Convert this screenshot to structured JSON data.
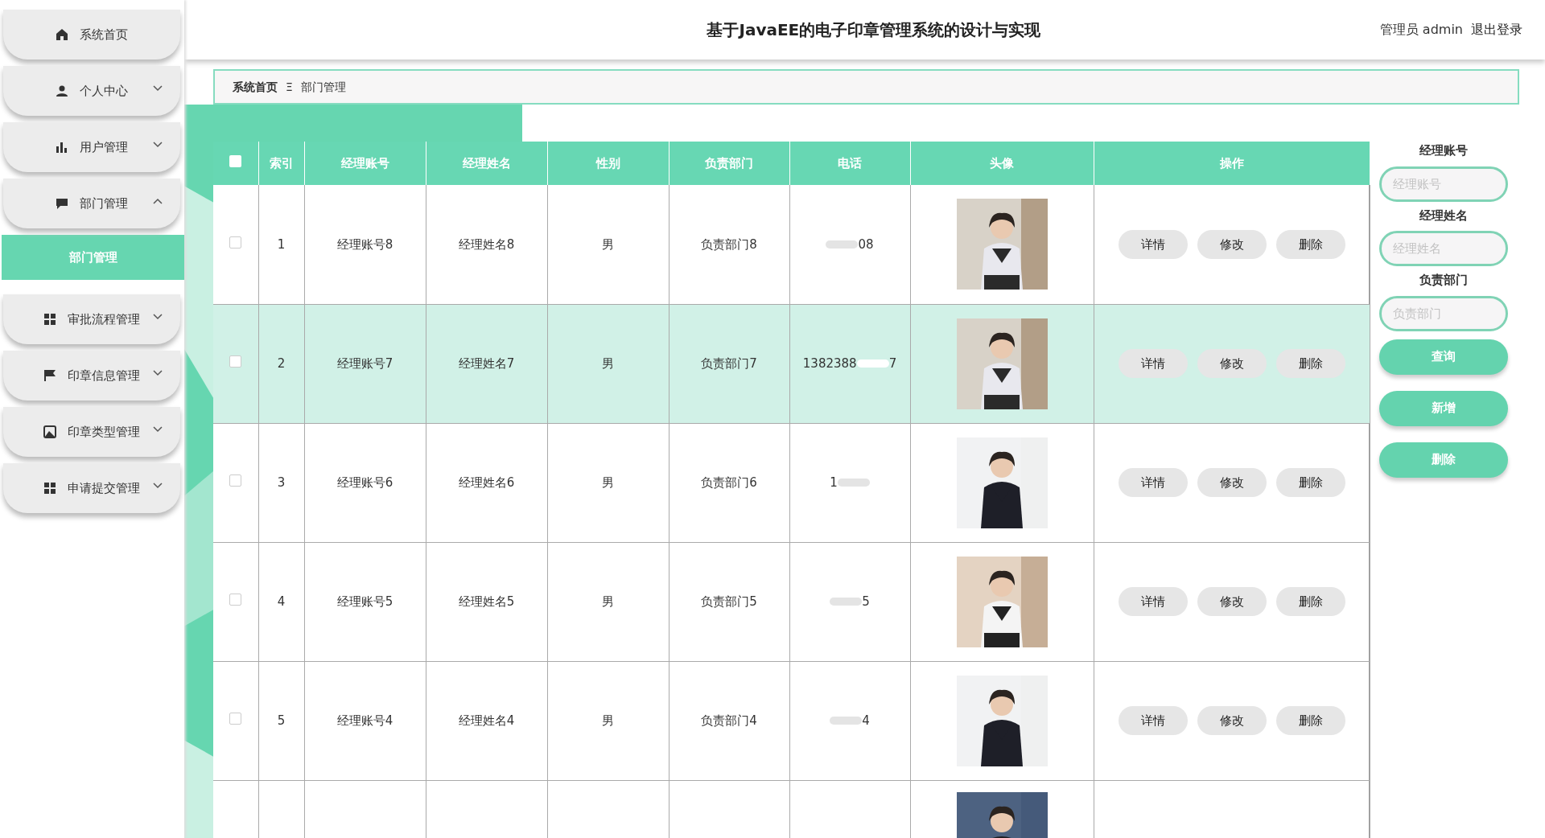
{
  "sidebar": {
    "items": [
      {
        "label": "系统首页",
        "kind": "link"
      },
      {
        "label": "个人中心",
        "kind": "menu",
        "expanded": false
      },
      {
        "label": "用户管理",
        "kind": "menu",
        "expanded": false
      },
      {
        "label": "部门管理",
        "kind": "menu",
        "expanded": true,
        "children": [
          {
            "label": "部门管理",
            "selected": true
          }
        ]
      },
      {
        "label": "审批流程管理",
        "kind": "menu",
        "expanded": false
      },
      {
        "label": "印章信息管理",
        "kind": "menu",
        "expanded": false
      },
      {
        "label": "印章类型管理",
        "kind": "menu",
        "expanded": false
      },
      {
        "label": "申请提交管理",
        "kind": "menu",
        "expanded": false
      }
    ]
  },
  "header": {
    "title": "基于JavaEE的电子印章管理系统的设计与实现",
    "user": "管理员 admin",
    "logout": "退出登录"
  },
  "breadcrumb": {
    "home": "系统首页",
    "separator": "Ξ",
    "current": "部门管理"
  },
  "table": {
    "select_all_checked": false,
    "columns": [
      "索引",
      "经理账号",
      "经理姓名",
      "性别",
      "负责部门",
      "电话",
      "头像",
      "操作"
    ],
    "rows": [
      {
        "kind": "full",
        "index": "1",
        "account": "经理账号8",
        "name": "经理姓名8",
        "gender": "男",
        "dept": "负责部门8",
        "phone_start": "",
        "phone_end": "08",
        "selected": false,
        "checked": false,
        "actions": [
          "详情",
          "修改",
          "删除"
        ]
      },
      {
        "kind": "full",
        "index": "2",
        "account": "经理账号7",
        "name": "经理姓名7",
        "gender": "男",
        "dept": "负责部门7",
        "phone_start": "1382388",
        "phone_end": "7",
        "selected": true,
        "checked": false,
        "actions": [
          "详情",
          "修改",
          "删除"
        ]
      },
      {
        "kind": "full",
        "index": "3",
        "account": "经理账号6",
        "name": "经理姓名6",
        "gender": "男",
        "dept": "负责部门6",
        "phone_start": "1",
        "phone_end": "",
        "selected": false,
        "checked": false,
        "actions": [
          "详情",
          "修改",
          "删除"
        ]
      },
      {
        "kind": "full",
        "index": "4",
        "account": "经理账号5",
        "name": "经理姓名5",
        "gender": "男",
        "dept": "负责部门5",
        "phone_start": "",
        "phone_end": "5",
        "selected": false,
        "checked": false,
        "actions": [
          "详情",
          "修改",
          "删除"
        ]
      },
      {
        "kind": "full",
        "index": "5",
        "account": "经理账号4",
        "name": "经理姓名4",
        "gender": "男",
        "dept": "负责部门4",
        "phone_start": "",
        "phone_end": "4",
        "selected": false,
        "checked": false,
        "actions": [
          "详情",
          "修改",
          "删除"
        ]
      },
      {
        "kind": "partial",
        "selected": false
      }
    ]
  },
  "search": {
    "fields": [
      {
        "label": "经理账号",
        "placeholder": "经理账号"
      },
      {
        "label": "经理姓名",
        "placeholder": "经理姓名"
      },
      {
        "label": "负责部门",
        "placeholder": "负责部门"
      }
    ],
    "buttons": [
      "查询",
      "新增",
      "删除"
    ]
  }
}
